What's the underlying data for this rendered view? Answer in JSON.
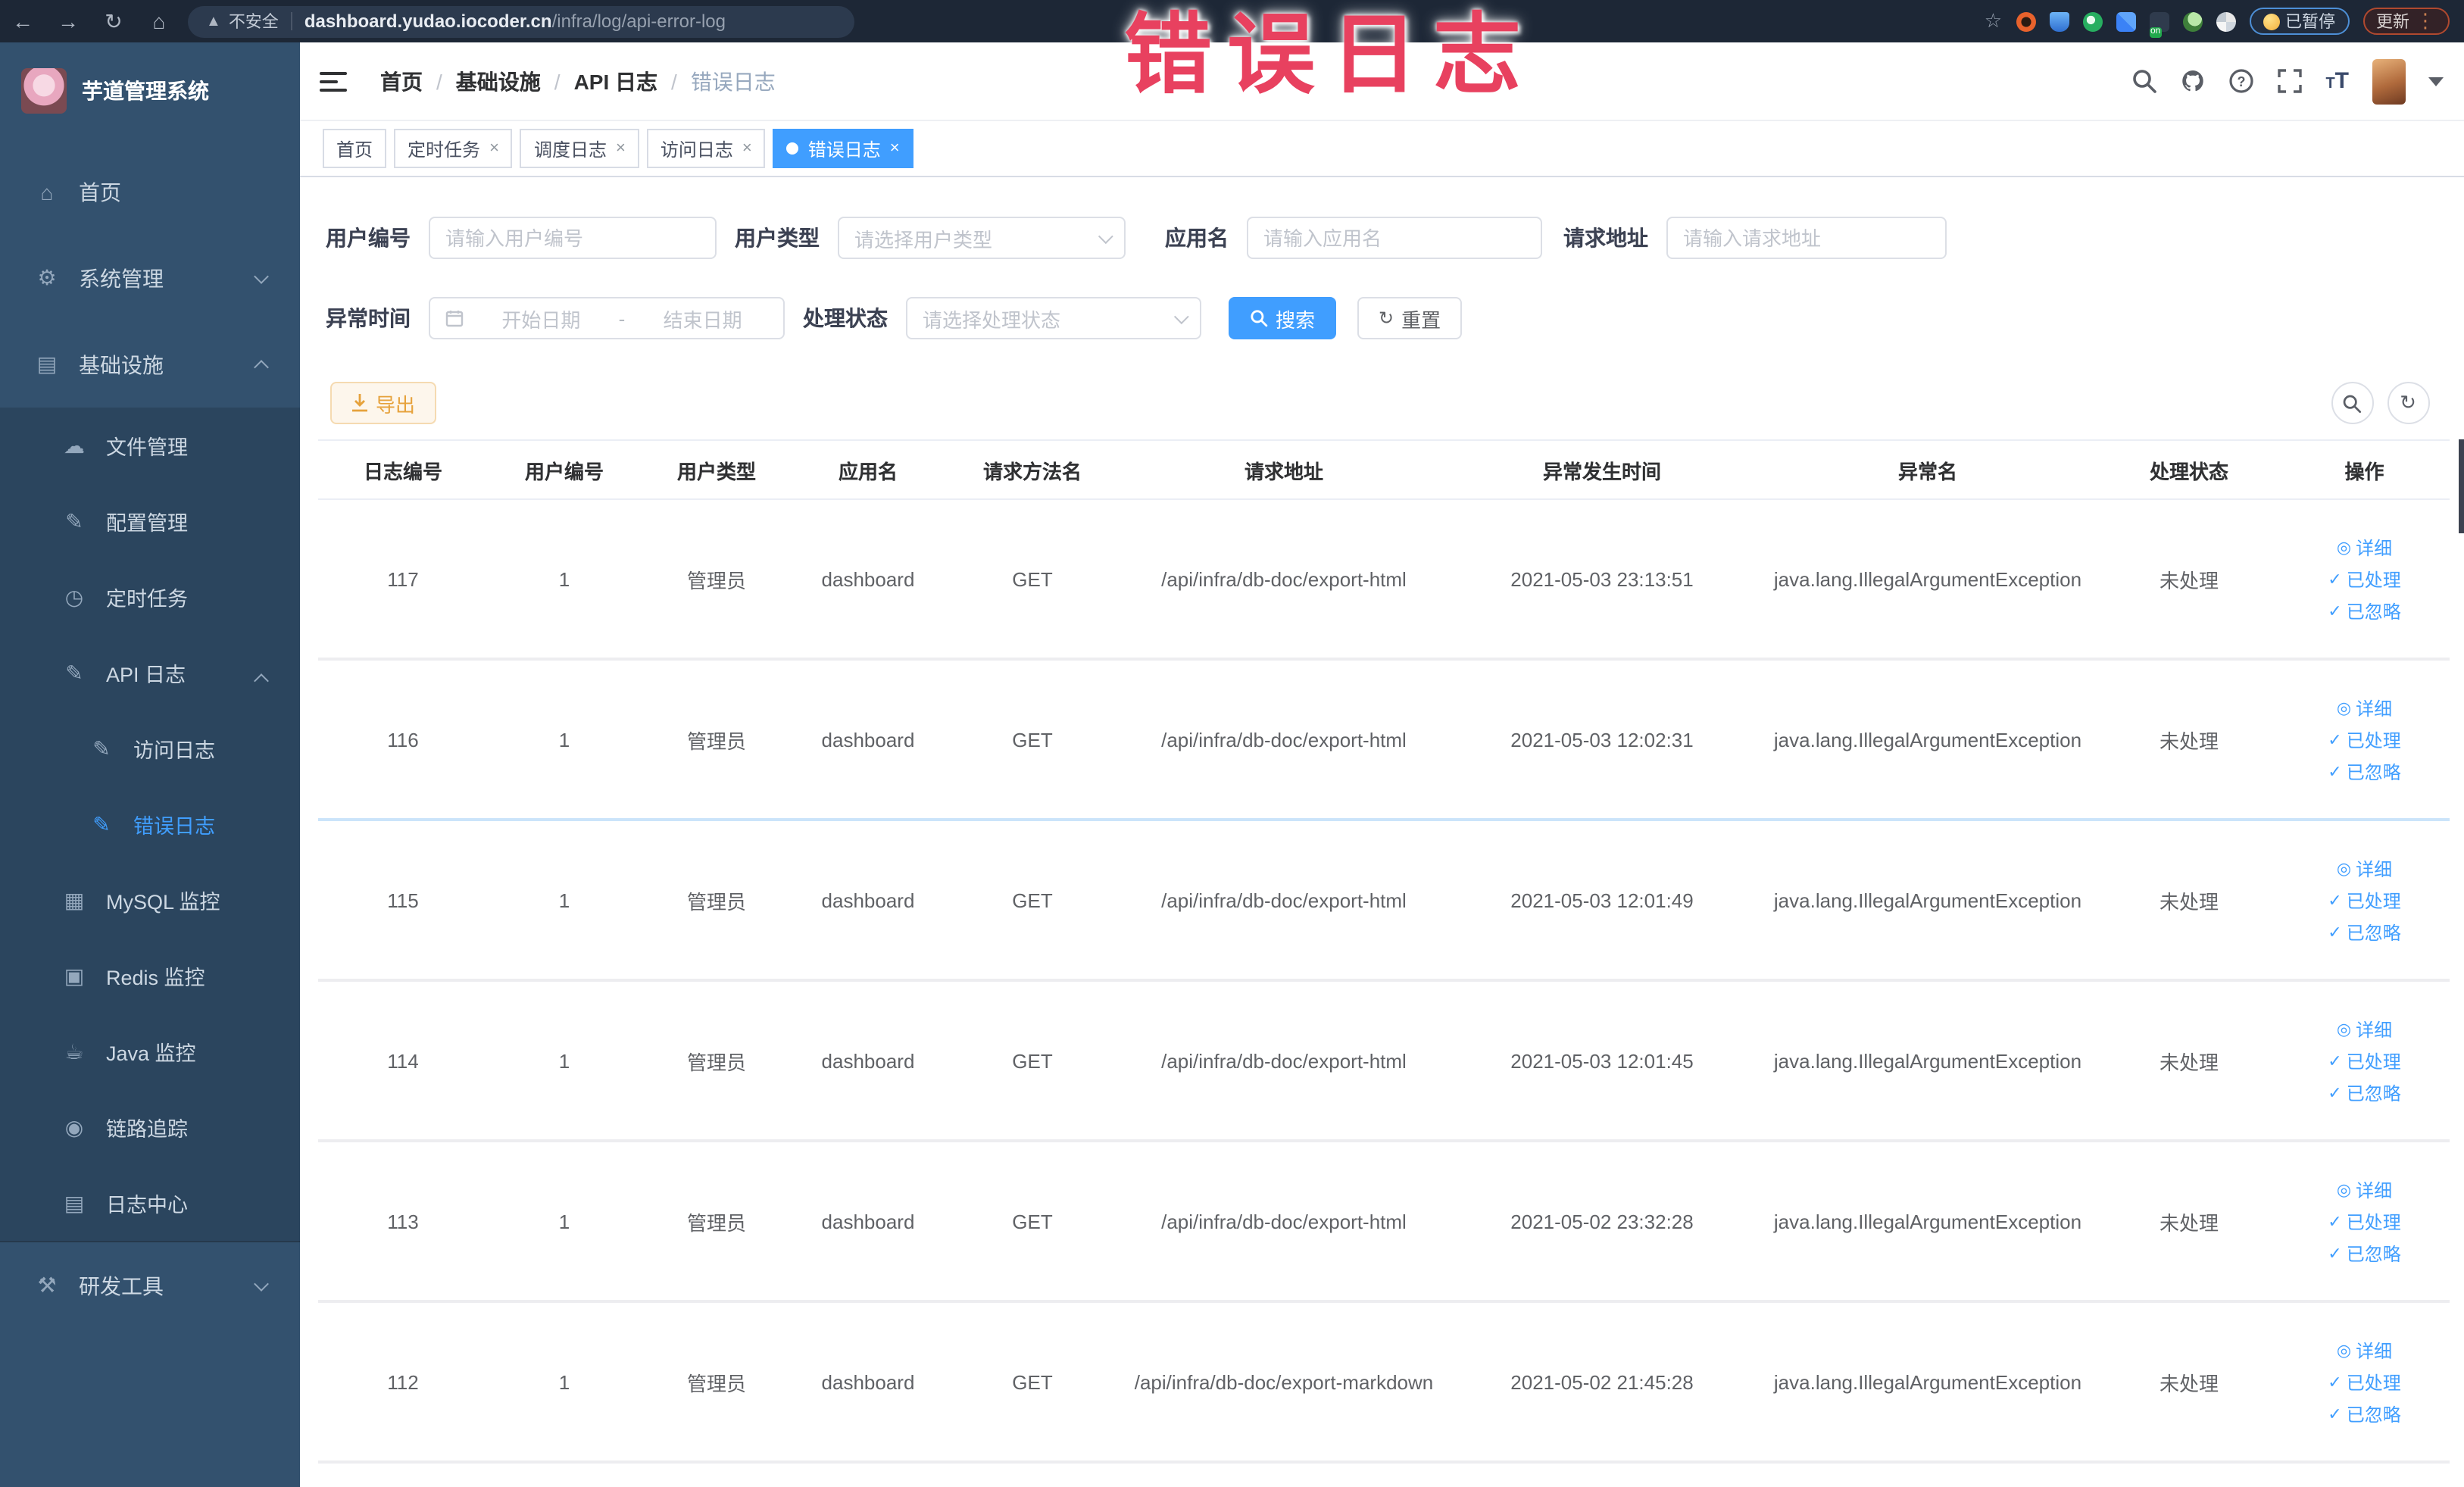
{
  "browser": {
    "security_label": "不安全",
    "url_host": "dashboard.yudao.iocoder.cn",
    "url_path": "/infra/log/api-error-log",
    "paused_badge": "已暂停",
    "update_button": "更新"
  },
  "annotation": {
    "text": "错误日志",
    "color": "#e8415f"
  },
  "sidebar": {
    "title": "芋道管理系统",
    "items": [
      {
        "label": "首页"
      },
      {
        "label": "系统管理"
      },
      {
        "label": "基础设施"
      },
      {
        "label": "文件管理"
      },
      {
        "label": "配置管理"
      },
      {
        "label": "定时任务"
      },
      {
        "label": "API 日志"
      },
      {
        "label": "访问日志"
      },
      {
        "label": "错误日志"
      },
      {
        "label": "MySQL 监控"
      },
      {
        "label": "Redis 监控"
      },
      {
        "label": "Java 监控"
      },
      {
        "label": "链路追踪"
      },
      {
        "label": "日志中心"
      },
      {
        "label": "研发工具"
      }
    ]
  },
  "header": {
    "breadcrumb": [
      "首页",
      "基础设施",
      "API 日志",
      "错误日志"
    ]
  },
  "tabs": [
    {
      "label": "首页"
    },
    {
      "label": "定时任务"
    },
    {
      "label": "调度日志"
    },
    {
      "label": "访问日志"
    },
    {
      "label": "错误日志"
    }
  ],
  "filters": {
    "user_id": {
      "label": "用户编号",
      "placeholder": "请输入用户编号"
    },
    "user_type": {
      "label": "用户类型",
      "placeholder": "请选择用户类型"
    },
    "app_name": {
      "label": "应用名",
      "placeholder": "请输入应用名"
    },
    "request_url": {
      "label": "请求地址",
      "placeholder": "请输入请求地址"
    },
    "exception_time": {
      "label": "异常时间",
      "start_placeholder": "开始日期",
      "separator": "-",
      "end_placeholder": "结束日期"
    },
    "process_status": {
      "label": "处理状态",
      "placeholder": "请选择处理状态"
    },
    "search_button": "搜索",
    "reset_button": "重置"
  },
  "toolbar": {
    "export_button": "导出"
  },
  "table": {
    "headers": [
      "日志编号",
      "用户编号",
      "用户类型",
      "应用名",
      "请求方法名",
      "请求地址",
      "异常发生时间",
      "异常名",
      "处理状态",
      "操作"
    ],
    "action_labels": [
      "详细",
      "已处理",
      "已忽略"
    ],
    "rows": [
      {
        "id": "117",
        "user_id": "1",
        "user_type": "管理员",
        "app": "dashboard",
        "method": "GET",
        "url": "/api/infra/db-doc/export-html",
        "time": "2021-05-03 23:13:51",
        "exception": "java.lang.IllegalArgumentException",
        "status": "未处理"
      },
      {
        "id": "116",
        "user_id": "1",
        "user_type": "管理员",
        "app": "dashboard",
        "method": "GET",
        "url": "/api/infra/db-doc/export-html",
        "time": "2021-05-03 12:02:31",
        "exception": "java.lang.IllegalArgumentException",
        "status": "未处理"
      },
      {
        "id": "115",
        "user_id": "1",
        "user_type": "管理员",
        "app": "dashboard",
        "method": "GET",
        "url": "/api/infra/db-doc/export-html",
        "time": "2021-05-03 12:01:49",
        "exception": "java.lang.IllegalArgumentException",
        "status": "未处理"
      },
      {
        "id": "114",
        "user_id": "1",
        "user_type": "管理员",
        "app": "dashboard",
        "method": "GET",
        "url": "/api/infra/db-doc/export-html",
        "time": "2021-05-03 12:01:45",
        "exception": "java.lang.IllegalArgumentException",
        "status": "未处理"
      },
      {
        "id": "113",
        "user_id": "1",
        "user_type": "管理员",
        "app": "dashboard",
        "method": "GET",
        "url": "/api/infra/db-doc/export-html",
        "time": "2021-05-02 23:32:28",
        "exception": "java.lang.IllegalArgumentException",
        "status": "未处理"
      },
      {
        "id": "112",
        "user_id": "1",
        "user_type": "管理员",
        "app": "dashboard",
        "method": "GET",
        "url": "/api/infra/db-doc/export-markdown",
        "time": "2021-05-02 21:45:28",
        "exception": "java.lang.IllegalArgumentException",
        "status": "未处理"
      }
    ]
  },
  "colors": {
    "accent": "#409eff",
    "warning": "#e6a23c",
    "annotation": "#e8415f",
    "sidebar_bg": "#33516e",
    "submenu_bg": "#2b455e",
    "chrome_bg": "#1d2736"
  }
}
